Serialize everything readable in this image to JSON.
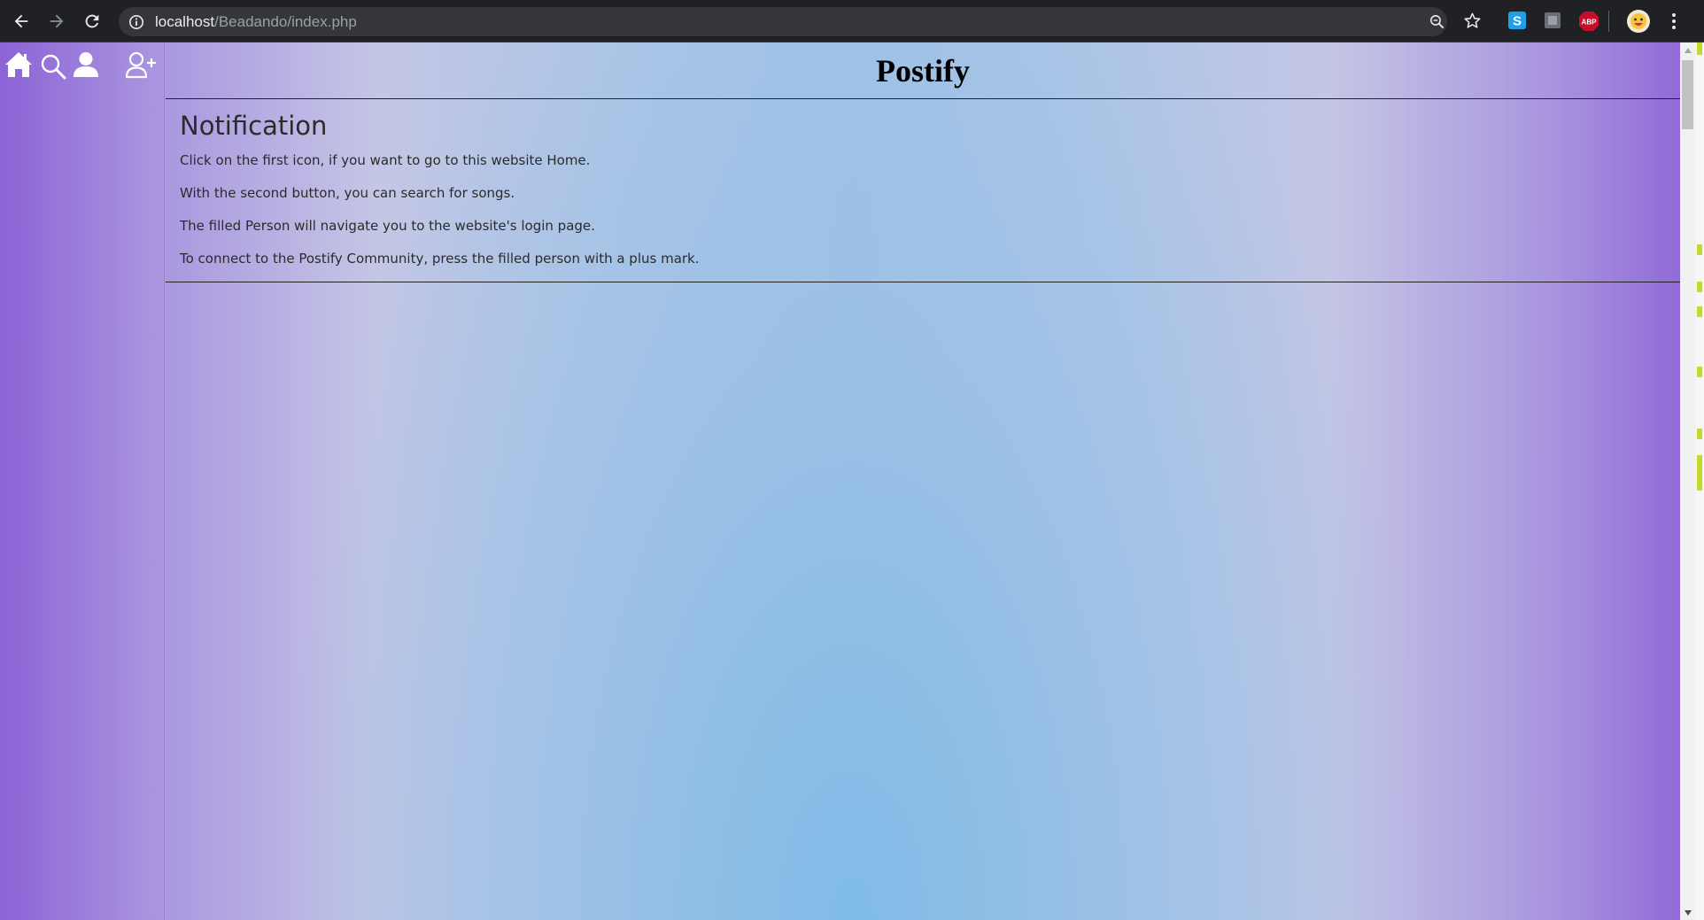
{
  "browser": {
    "url_host": "localhost",
    "url_path": "/Beadando/index.php",
    "extensions": [
      "skype-icon",
      "generic-extension-icon",
      "adblock-plus-icon"
    ],
    "adblock_label": "ABP"
  },
  "sidebar": {
    "icons": [
      "home-icon",
      "search-icon",
      "login-person-icon",
      "add-person-icon"
    ]
  },
  "header": {
    "title": "Postify"
  },
  "notification": {
    "heading": "Notification",
    "lines": [
      "Click on the first icon, if you want to go to this website Home.",
      "With the second button, you can search for songs.",
      "The filled Person will navigate you to the website's login page.",
      "To connect to the Postify Community, press the filled person with a plus mark."
    ]
  },
  "colors": {
    "chrome_bg": "#202124",
    "edge_purple": "#8c63d6",
    "center_blue": "#7fbbe7",
    "text_dark": "#2b2b2b"
  }
}
